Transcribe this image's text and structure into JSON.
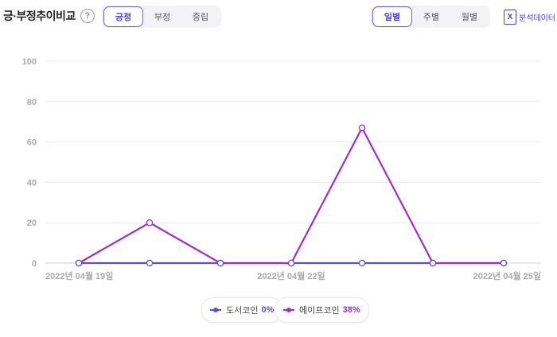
{
  "header": {
    "title": "긍·부정추이비교",
    "help_icon": "?"
  },
  "sentiment_tabs": [
    {
      "label": "긍정",
      "active": true
    },
    {
      "label": "부정",
      "active": false
    },
    {
      "label": "중립",
      "active": false
    }
  ],
  "period_tabs": [
    {
      "label": "일별",
      "active": true
    },
    {
      "label": "주별",
      "active": false
    },
    {
      "label": "월별",
      "active": false
    }
  ],
  "export": {
    "label": "분석데이터",
    "icon": "excel-icon",
    "icon_letter": "X"
  },
  "colors": {
    "accent": "#4b3ed6",
    "series_a": "#5b4de0",
    "series_b": "#a12ec4"
  },
  "chart_data": {
    "type": "line",
    "x": [
      "2022-04-19",
      "2022-04-20",
      "2022-04-21",
      "2022-04-22",
      "2022-04-23",
      "2022-04-24",
      "2022-04-25"
    ],
    "x_tick_labels": [
      {
        "index": 0,
        "label": "2022년 04월 19일"
      },
      {
        "index": 3,
        "label": "2022년 04월 22일"
      },
      {
        "index": 6,
        "label": "2022년 04월 25일"
      }
    ],
    "ylim": [
      0,
      100
    ],
    "y_ticks": [
      0,
      20,
      40,
      60,
      80,
      100
    ],
    "grid": true,
    "legend_position": "bottom",
    "series": [
      {
        "name": "도서코인",
        "percent": "0%",
        "color": "#5b4de0",
        "values": [
          0,
          0,
          0,
          0,
          0,
          0,
          0
        ]
      },
      {
        "name": "에이프코인",
        "percent": "38%",
        "color": "#a12ec4",
        "values": [
          0,
          20,
          0,
          0,
          67,
          0,
          0
        ]
      }
    ]
  }
}
